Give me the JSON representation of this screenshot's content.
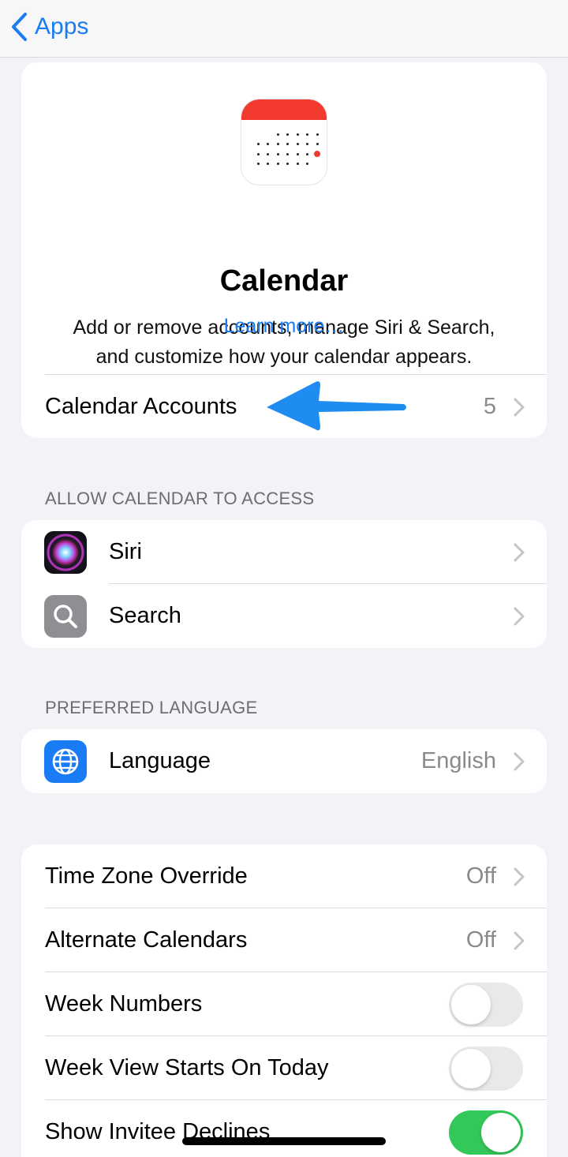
{
  "nav": {
    "back_label": "Apps"
  },
  "header": {
    "app_name": "Calendar",
    "description_line1": "Add or remove accounts, manage Siri & Search,",
    "description_line2": "and customize how your calendar appears.",
    "learn_more": "Learn more…",
    "accounts_label": "Calendar Accounts",
    "accounts_count": "5"
  },
  "access_section": {
    "header": "ALLOW CALENDAR TO ACCESS",
    "items": [
      {
        "label": "Siri",
        "icon": "siri-icon"
      },
      {
        "label": "Search",
        "icon": "search-icon"
      }
    ]
  },
  "language_section": {
    "header": "PREFERRED LANGUAGE",
    "label": "Language",
    "value": "English",
    "icon": "globe-icon"
  },
  "settings": {
    "time_zone": {
      "label": "Time Zone Override",
      "value": "Off"
    },
    "alternate": {
      "label": "Alternate Calendars",
      "value": "Off"
    },
    "week_numbers": {
      "label": "Week Numbers",
      "on": false
    },
    "week_view": {
      "label": "Week View Starts On Today",
      "on": false
    },
    "invitee_declines": {
      "label": "Show Invitee Declines",
      "on": true
    }
  },
  "colors": {
    "accent": "#1a7cf5",
    "toggle_on": "#34c759",
    "annotation_arrow": "#1e8cf0"
  }
}
